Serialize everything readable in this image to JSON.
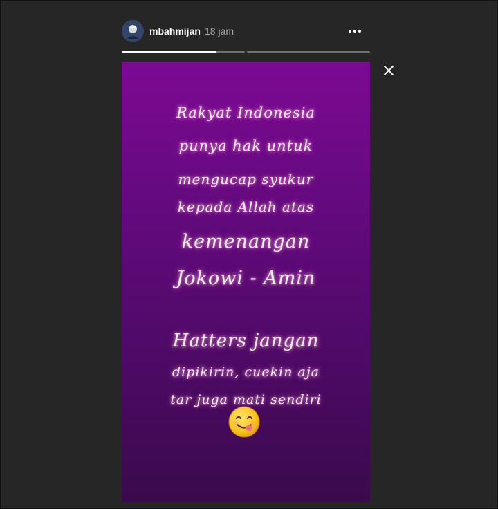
{
  "header": {
    "username": "mbahmijan",
    "timestamp": "18 jam",
    "more_icon": "more-horizontal-icon"
  },
  "progress": {
    "segments": [
      0.77,
      0.0
    ],
    "active_index": 0
  },
  "close_icon": "close-icon",
  "story": {
    "lines": [
      "Rakyat Indonesia",
      "punya hak untuk",
      "mengucap syukur",
      "kepada Allah atas",
      "kemenangan",
      "Jokowi - Amin",
      "Hatters jangan",
      "dipikirin, cuekin aja",
      "tar juga mati sendiri"
    ],
    "sticker": "yum-face-emoji"
  },
  "colors": {
    "background": "#262626",
    "story_top": "#7c0a93",
    "story_bottom": "#3a0a4c",
    "text_glow": "#ff9ad8"
  }
}
